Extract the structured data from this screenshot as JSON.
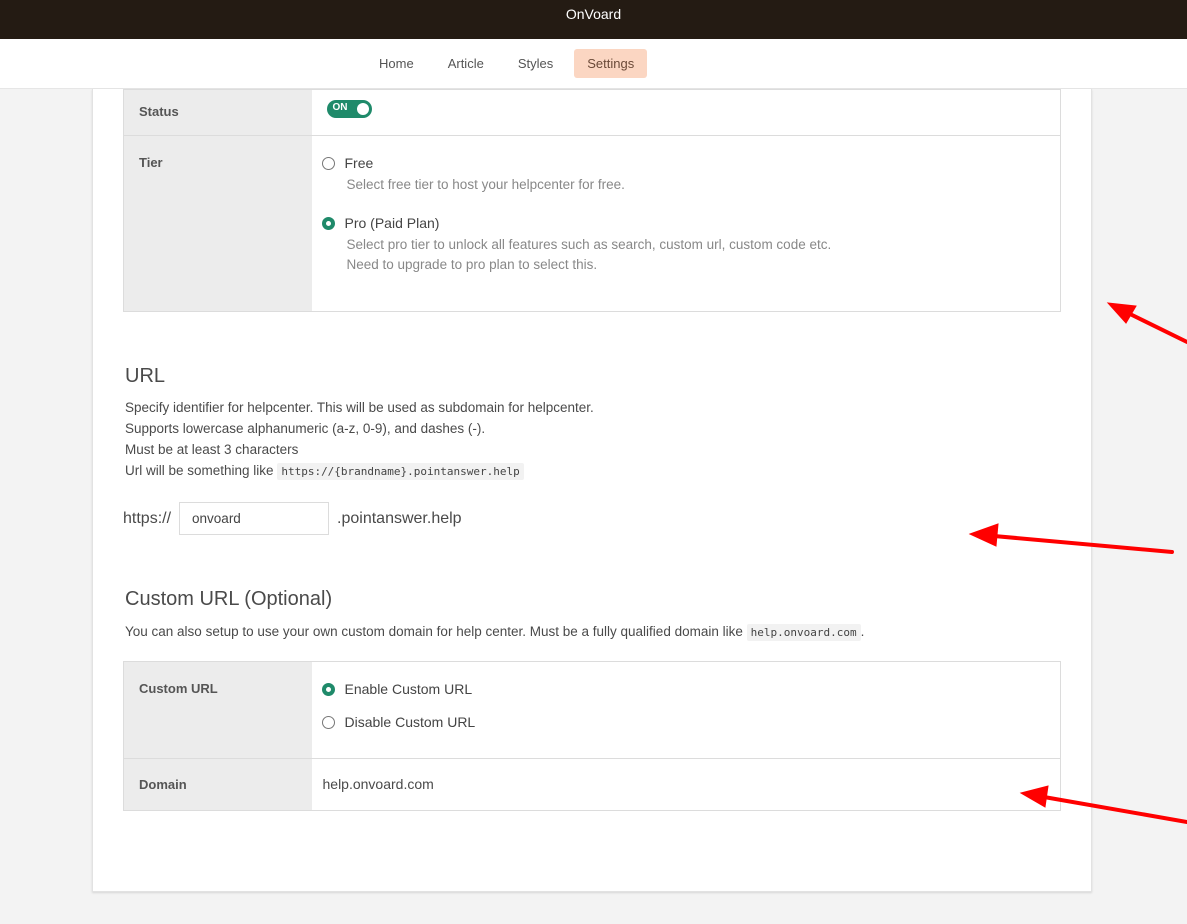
{
  "app": {
    "title": "OnVoard"
  },
  "nav": {
    "items": [
      {
        "label": "Home"
      },
      {
        "label": "Article"
      },
      {
        "label": "Styles"
      },
      {
        "label": "Settings"
      }
    ],
    "active": "Settings"
  },
  "settings": {
    "status_label": "Status",
    "status_toggle": "ON",
    "tier_label": "Tier",
    "tier_options": [
      {
        "label": "Free",
        "help": [
          "Select free tier to host your helpcenter for free."
        ],
        "checked": false
      },
      {
        "label": "Pro (Paid Plan)",
        "help": [
          "Select pro tier to unlock all features such as search, custom url, custom code etc.",
          "Need to upgrade to pro plan to select this."
        ],
        "checked": true
      }
    ]
  },
  "url": {
    "heading": "URL",
    "lines": [
      "Specify identifier for helpcenter. This will be used as subdomain for helpcenter.",
      "Supports lowercase alphanumeric (a-z, 0-9), and dashes (-).",
      "Must be at least 3 characters",
      "Url will be something like"
    ],
    "example_code": "https://{brandname}.pointanswer.help",
    "prefix": "https://",
    "value": "onvoard",
    "suffix": ".pointanswer.help"
  },
  "custom_url": {
    "heading": "Custom URL (Optional)",
    "description": "You can also setup to use your own custom domain for help center. Must be a fully qualified domain like",
    "example_code": "help.onvoard.com",
    "description_end": ".",
    "row_label": "Custom URL",
    "options": [
      {
        "label": "Enable Custom URL",
        "checked": true
      },
      {
        "label": "Disable Custom URL",
        "checked": false
      }
    ],
    "domain_label": "Domain",
    "domain_value": "help.onvoard.com"
  },
  "colors": {
    "topbar": "#241b13",
    "accent": "#1f8a6a",
    "active_tab": "#fbd6c2",
    "annotation_arrow": "#ff0000"
  }
}
